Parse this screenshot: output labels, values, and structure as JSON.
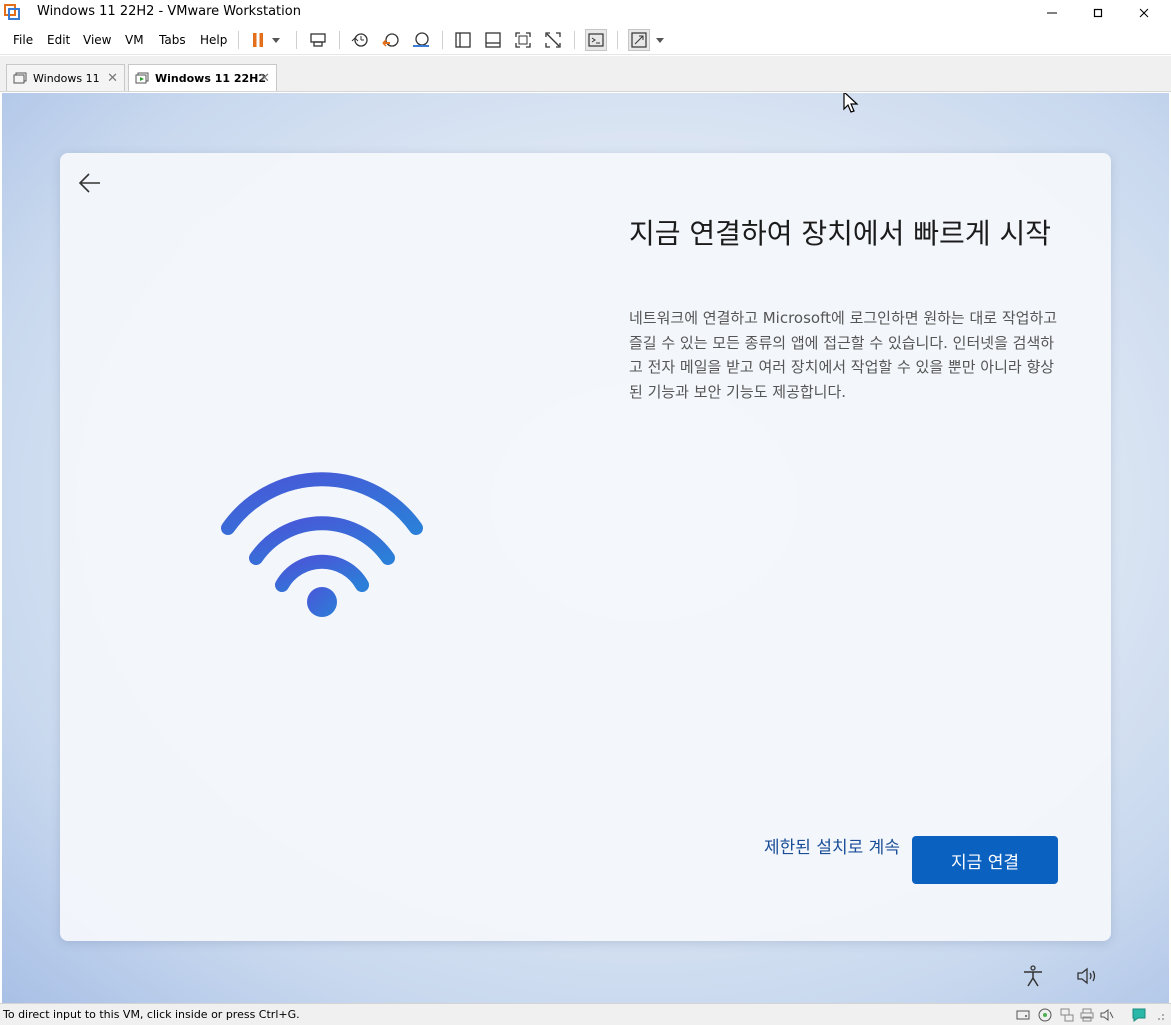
{
  "window": {
    "title": "Windows 11 22H2 - VMware Workstation"
  },
  "menu": [
    "File",
    "Edit",
    "View",
    "VM",
    "Tabs",
    "Help"
  ],
  "toolbar_icons": [
    "pause-icon",
    "dropdown-icon",
    "send-ctrl-alt-del-icon",
    "snapshot-icon",
    "revert-snapshot-icon",
    "snapshot-manager-icon",
    "show-library-icon",
    "thumbnail-bar-icon",
    "full-screen-icon",
    "unity-icon",
    "console-view-icon",
    "stretch-guest-icon",
    "dropdown-icon"
  ],
  "tabs": [
    {
      "label": "Windows 11",
      "active": false
    },
    {
      "label": "Windows 11 22H2",
      "active": true
    }
  ],
  "oobe": {
    "heading": "지금 연결하여 장치에서 빠르게 시작",
    "description": "네트워크에 연결하고 Microsoft에 로그인하면 원하는 대로 작업하고 즐길 수 있는 모든 종류의 앱에 접근할 수 있습니다. 인터넷을 검색하고 전자 메일을 받고 여러 장치에서 작업할 수 있을 뿐만 아니라 향상된 기능과 보안 기능도 제공합니다.",
    "skip_label": "제한된 설치로 계속",
    "connect_label": "지금 연결",
    "accent": "#0b61c0"
  },
  "status": {
    "text": "To direct input to this VM, click inside or press Ctrl+G."
  }
}
